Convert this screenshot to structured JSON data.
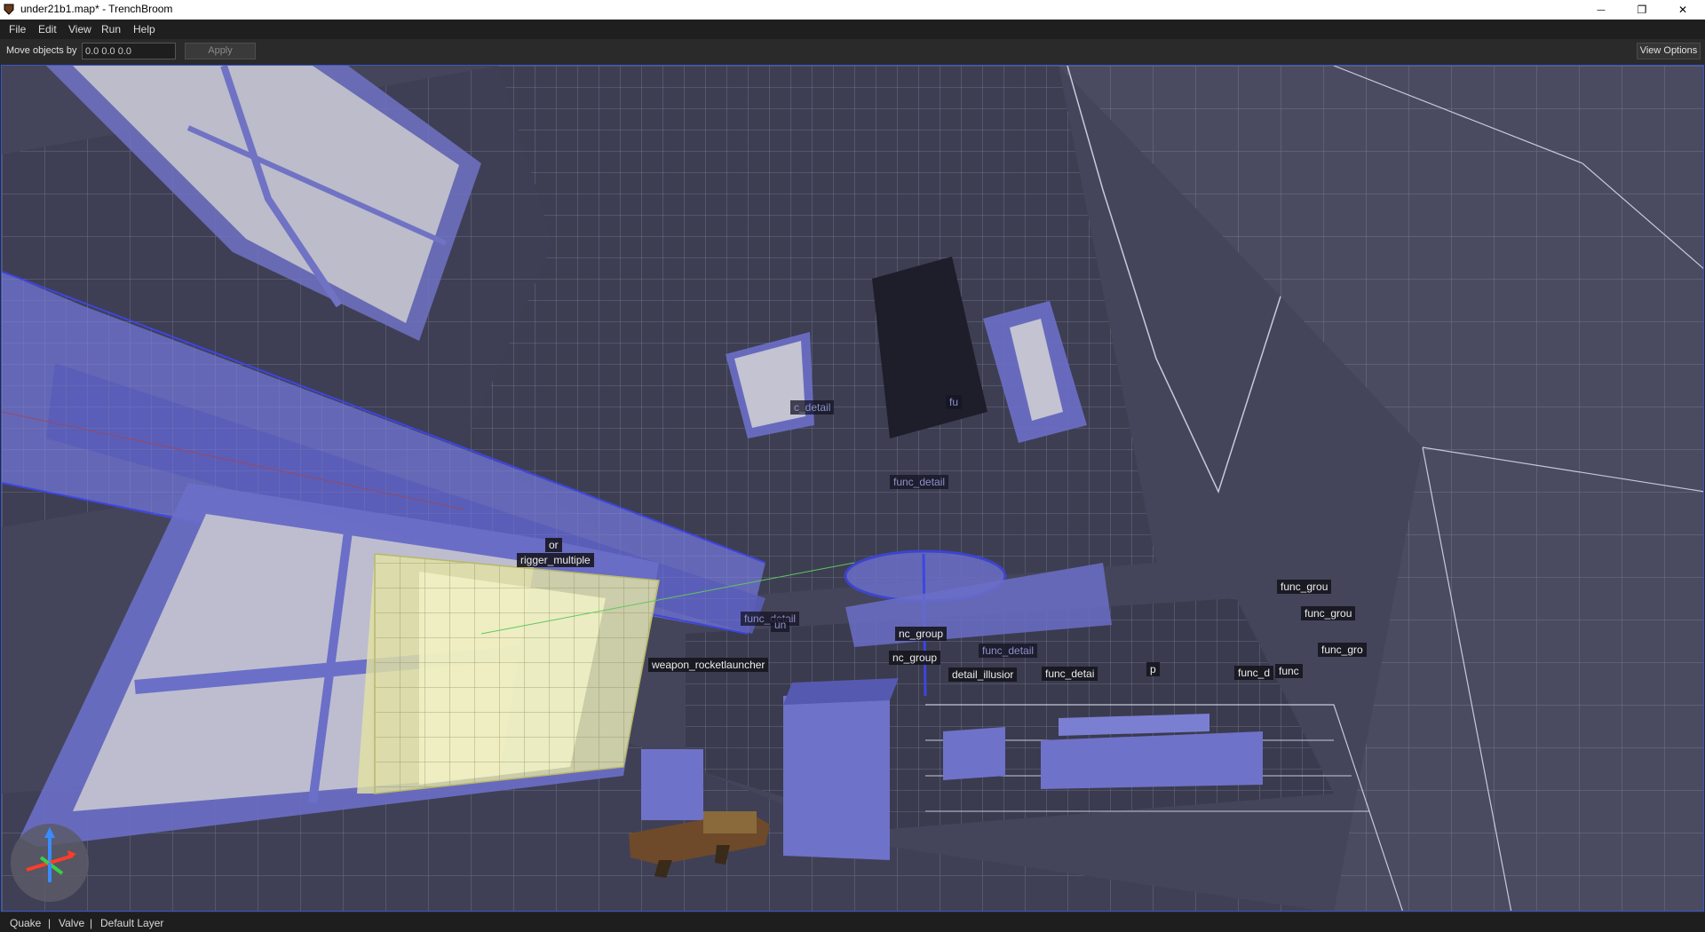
{
  "window": {
    "title": "under21b1.map* - TrenchBroom",
    "minimize_glyph": "—",
    "restore_glyph": "❐",
    "close_glyph": "✕"
  },
  "menu": {
    "file": "File",
    "edit": "Edit",
    "view": "View",
    "run": "Run",
    "help": "Help"
  },
  "toolbar": {
    "move_label": "Move objects by",
    "move_value": "0.0 0.0 0.0",
    "apply_label": "Apply",
    "view_options_label": "View Options"
  },
  "viewport": {
    "labels": {
      "c_detail": "c_detail",
      "fu": "fu",
      "func_detail_top": "func_detail",
      "or": "or",
      "trigger_multiple": "rigger_multiple",
      "func_detail_mid": "func_detail",
      "un": "un",
      "func_group_a": "nc_group",
      "func_group_b": "nc_group",
      "weapon": "weapon_rocketlauncher",
      "func_detail_c": "func_detail",
      "detail_illusion": "detail_illusior",
      "func_detail_d": "func_detai",
      "p": "p",
      "func_d": "func_d",
      "func_e": "func",
      "func_grou_1": "func_grou",
      "func_grou_2": "func_grou",
      "func_gro_3": "func_gro"
    },
    "colors": {
      "wall_dark": "#44455a",
      "brush_selected": "#6b6fc8",
      "trigger_yellow": "#d9d98a",
      "window_pane": "#b9b9c9"
    },
    "icons": {
      "axis_gizmo": "axis-gizmo-icon",
      "rocket_launcher": "rocket-launcher-model"
    }
  },
  "status": {
    "game": "Quake",
    "format": "Valve",
    "layer": "Default Layer",
    "sep1": "|",
    "sep2": "|"
  }
}
